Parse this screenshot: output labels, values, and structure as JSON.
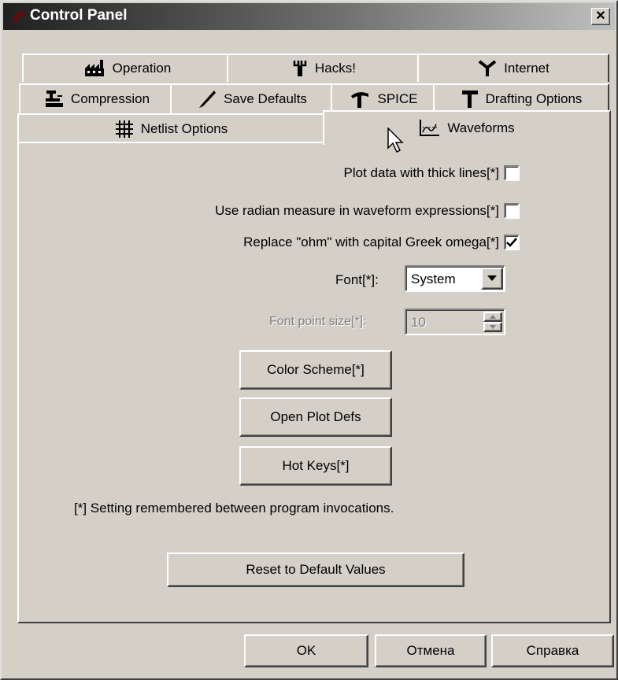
{
  "window": {
    "title": "Control Panel",
    "close_symbol": "✕"
  },
  "tabs": {
    "row1": [
      "Operation",
      "Hacks!",
      "Internet"
    ],
    "row2": [
      "Compression",
      "Save Defaults",
      "SPICE",
      "Drafting Options"
    ],
    "row3": [
      "Netlist Options",
      "Waveforms"
    ],
    "active": "Waveforms"
  },
  "waveforms": {
    "thick_lines_label": "Plot data with thick lines[*]",
    "thick_lines_checked": false,
    "radian_label": "Use radian measure in waveform expressions[*]",
    "radian_checked": false,
    "omega_label": "Replace \"ohm\" with capital Greek omega[*]",
    "omega_checked": true,
    "font_label": "Font[*]:",
    "font_value": "System",
    "font_size_label": "Font point size[*]:",
    "font_size_value": "10",
    "color_scheme_button": "Color Scheme[*]",
    "open_plot_defs_button": "Open Plot Defs",
    "hot_keys_button": "Hot Keys[*]",
    "note": "[*] Setting remembered between program invocations.",
    "reset_button": "Reset to Default Values"
  },
  "footer": {
    "ok": "OK",
    "cancel": "Отмена",
    "help": "Справка"
  }
}
